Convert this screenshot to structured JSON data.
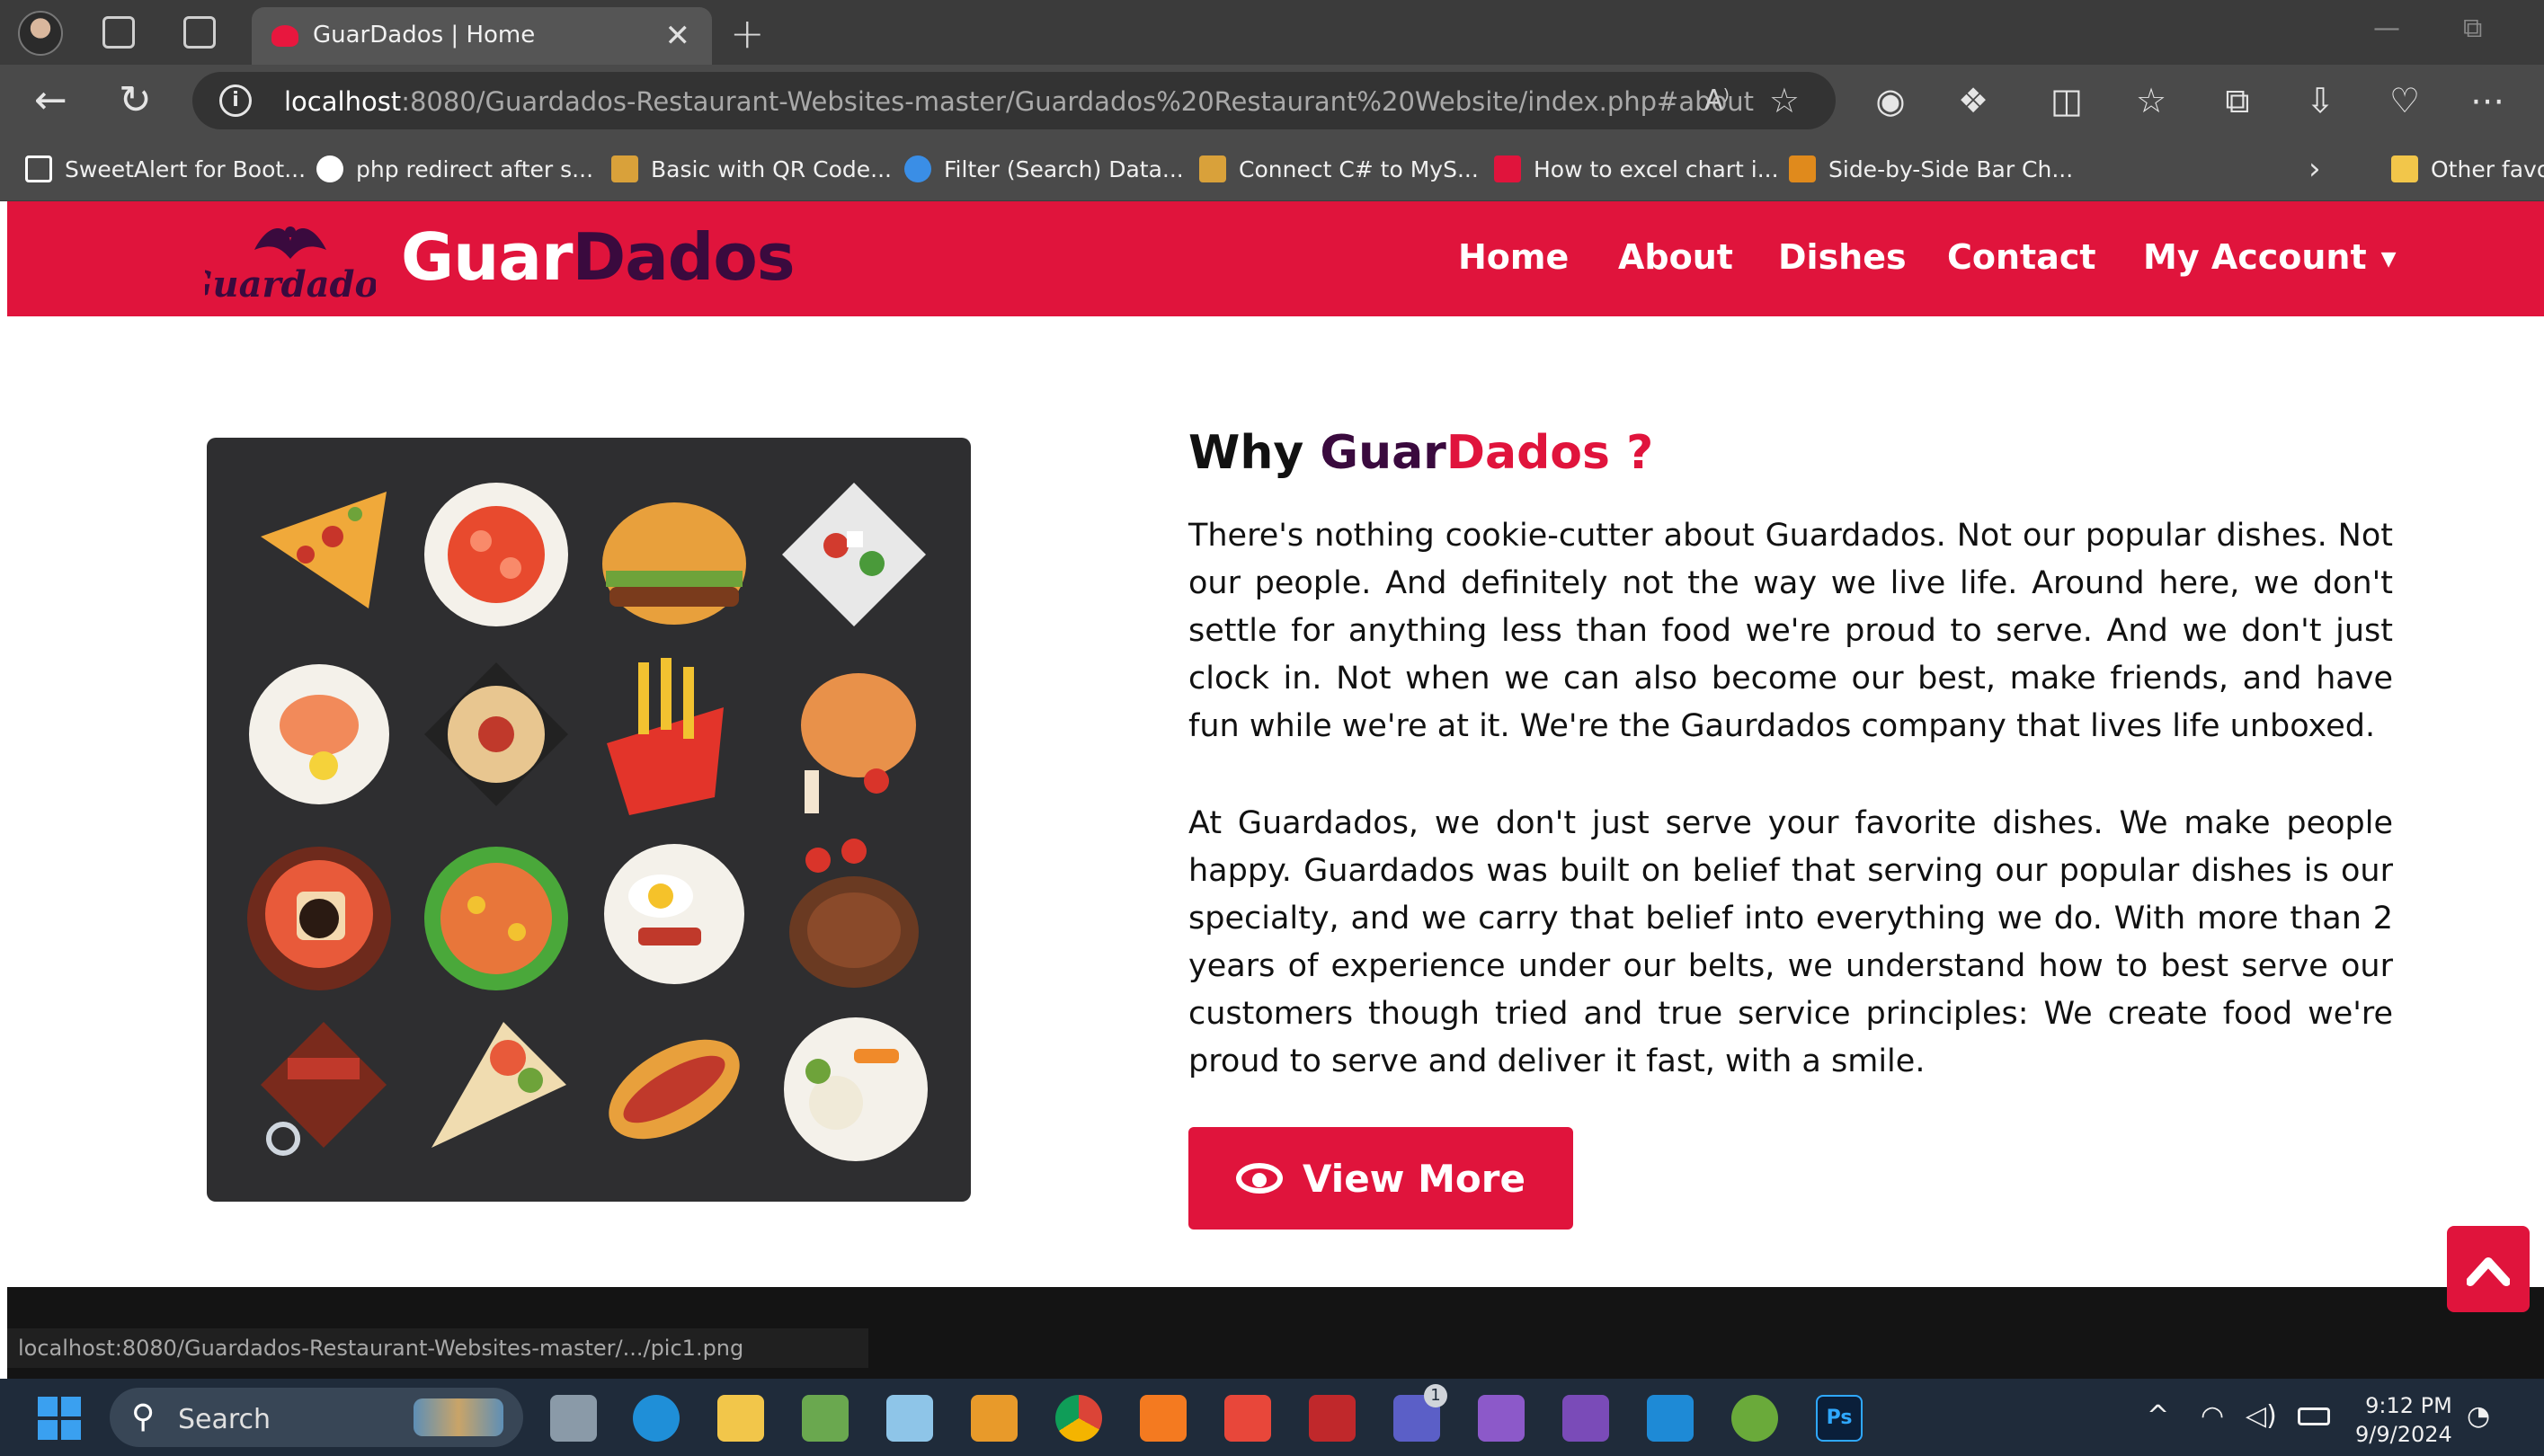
{
  "browser": {
    "tab_title": "GuarDados | Home",
    "close_glyph": "✕",
    "new_tab_glyph": "+",
    "url_host": "localhost",
    "url_rest": ":8080/Guardados-Restaurant-Websites-master/Guardados%20Restaurant%20Website/index.php#about",
    "info_glyph": "i",
    "read_aloud_glyph": "A⁾",
    "favorite_glyph": "☆",
    "bookmarks": [
      {
        "label": "SweetAlert for Boot...",
        "color": "#ffffff"
      },
      {
        "label": "php redirect after s...",
        "color": "#ffffff"
      },
      {
        "label": "Basic with QR Code...",
        "color": "#d9a13a"
      },
      {
        "label": "Filter (Search) Data...",
        "color": "#3a8ee6"
      },
      {
        "label": "Connect C# to MyS...",
        "color": "#d9a13a"
      },
      {
        "label": "How to excel chart i...",
        "color": "#e0143c"
      },
      {
        "label": "Side-by-Side Bar Ch...",
        "color": "#e08a1c"
      }
    ],
    "other_favorites": "Other favo",
    "status_url": "localhost:8080/Guardados-Restaurant-Websites-master/.../pic1.png"
  },
  "site": {
    "brand_part1": "Guar",
    "brand_part2": "Dados",
    "logo_text": "Guardados",
    "nav": [
      "Home",
      "About",
      "Dishes",
      "Contact",
      "My Account"
    ],
    "account_caret": "▼"
  },
  "about": {
    "heading_prefix": "Why ",
    "heading_guar": "Guar",
    "heading_dados": "Dados ?",
    "paragraph1": "There's nothing cookie-cutter about Guardados. Not our popular dishes. Not our people. And definitely not the way we live life. Around here, we don't settle for anything less than food we're proud to serve. And we don't just clock in. Not when we can also become our best, make friends, and have fun while we're at it. We're the Gaurdados company that lives life unboxed.",
    "paragraph2": "At Guardados, we don't just serve your favorite dishes. We make people happy. Guardados was built on belief that serving our popular dishes is our specialty, and we carry that belief into everything we do. With more than 2 years of experience under our belts, we understand how to best serve our customers though tried and true service principles: We create food we're proud to serve and deliver it fast, with a smile.",
    "button_label": "View More"
  },
  "taskbar": {
    "search_label": "Search",
    "search_glyph": "⚲",
    "time": "9:12 PM",
    "date": "9/9/2024",
    "teams_badge": "1",
    "photoshop_label": "Ps",
    "tray_chevron": "^",
    "wifi_glyph": "◠",
    "volume_glyph": "◁)",
    "bell_glyph": "◔"
  },
  "colors": {
    "brand_red": "#e0143c",
    "brand_purple": "#3a0a3e",
    "image_bg": "#2e2e30"
  }
}
